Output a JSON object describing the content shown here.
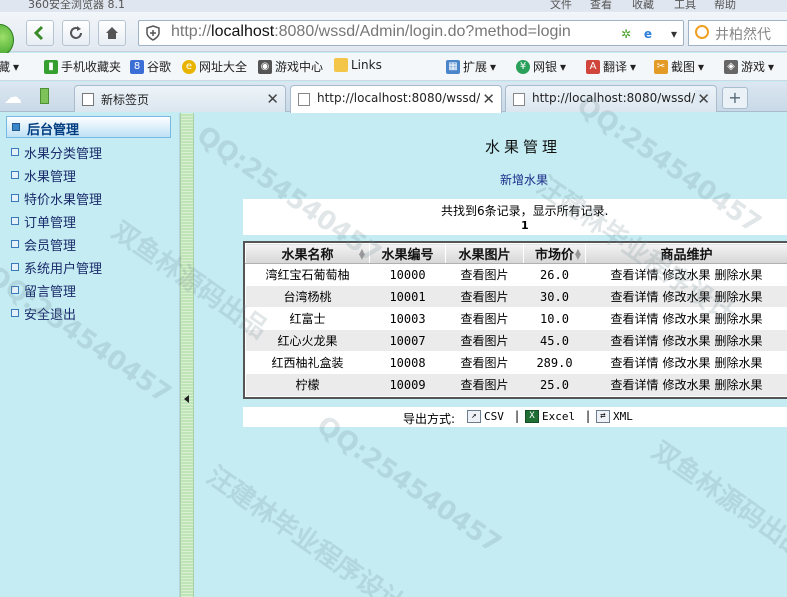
{
  "browser": {
    "window_title": "360安全浏览器 8.1",
    "menu": [
      "文件",
      "查看",
      "收藏",
      "工具",
      "帮助"
    ],
    "address": {
      "prefix": "http://",
      "host": "localhost",
      "rest": ":8080/wssd/Admin/login.do?method=login"
    },
    "search_placeholder": "井柏然代"
  },
  "favorites": [
    {
      "label": "藏",
      "icon": "dropdown-icon"
    },
    {
      "label": "手机收藏夹",
      "icon": "phone-icon"
    },
    {
      "label": "谷歌",
      "icon": "google-icon"
    },
    {
      "label": "网址大全",
      "icon": "globe-icon"
    },
    {
      "label": "游戏中心",
      "icon": "gamepad-icon"
    },
    {
      "label": "Links",
      "icon": "folder-icon"
    },
    {
      "label": "扩展",
      "icon": "grid-icon"
    },
    {
      "label": "网银",
      "icon": "bank-icon"
    },
    {
      "label": "翻译",
      "icon": "translate-icon"
    },
    {
      "label": "截图",
      "icon": "scissors-icon"
    },
    {
      "label": "游戏",
      "icon": "game-icon"
    }
  ],
  "tabs": [
    {
      "label": "新标签页",
      "active": false
    },
    {
      "label": "http://localhost:8080/wssd/",
      "active": true
    },
    {
      "label": "http://localhost:8080/wssd/",
      "active": false
    }
  ],
  "sidebar": {
    "header": "后台管理",
    "items": [
      {
        "label": "水果分类管理"
      },
      {
        "label": "水果管理"
      },
      {
        "label": "特价水果管理"
      },
      {
        "label": "订单管理"
      },
      {
        "label": "会员管理"
      },
      {
        "label": "系统用户管理"
      },
      {
        "label": "留言管理"
      },
      {
        "label": "安全退出"
      }
    ]
  },
  "main": {
    "title": "水果管理",
    "add_link": "新增水果",
    "found_text": "共找到6条记录，显示所有记录.",
    "page_number": "1",
    "table": {
      "headers": [
        "水果名称",
        "水果编号",
        "水果图片",
        "市场价",
        "商品维护"
      ],
      "rows": [
        {
          "name": "湾红宝石葡萄柚",
          "code": "10000",
          "image": "查看图片",
          "price": "26.0"
        },
        {
          "name": "台湾杨桃",
          "code": "10001",
          "image": "查看图片",
          "price": "30.0"
        },
        {
          "name": "红富士",
          "code": "10003",
          "image": "查看图片",
          "price": "10.0"
        },
        {
          "name": "红心火龙果",
          "code": "10007",
          "image": "查看图片",
          "price": "45.0"
        },
        {
          "name": "红西柚礼盒装",
          "code": "10008",
          "image": "查看图片",
          "price": "289.0"
        },
        {
          "name": "柠檬",
          "code": "10009",
          "image": "查看图片",
          "price": "25.0"
        }
      ],
      "actions": [
        "查看详情",
        "修改水果",
        "删除水果"
      ]
    },
    "export": {
      "label": "导出方式:",
      "options": [
        "CSV",
        "Excel",
        "XML"
      ],
      "separator": "|"
    }
  },
  "watermarks": [
    "QQ:254540457",
    "双鱼林源码出品",
    "汪建林毕业程序设计"
  ]
}
